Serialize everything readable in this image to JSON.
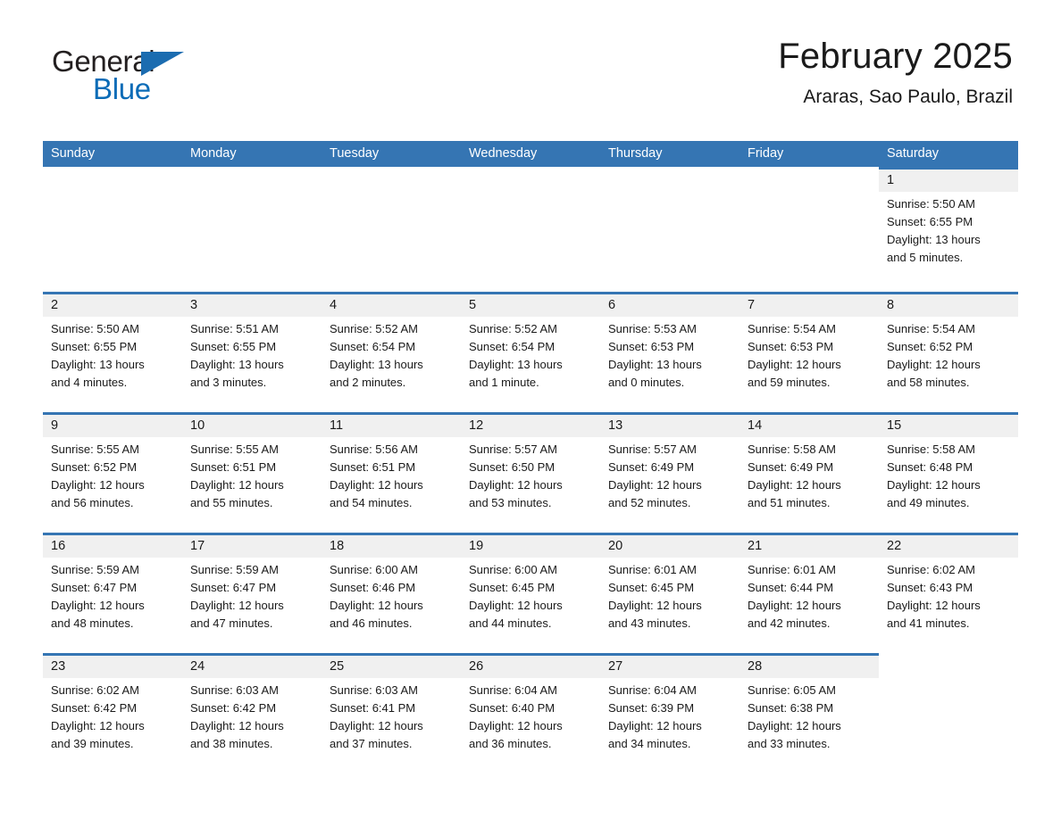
{
  "brand": {
    "name_part1": "General",
    "name_part2": "Blue",
    "logo_icon": "triangle-icon",
    "accent_color": "#0b6cb7"
  },
  "header": {
    "title": "February 2025",
    "subtitle": "Araras, Sao Paulo, Brazil"
  },
  "theme": {
    "header_bar_color": "#3575b3",
    "day_band_color": "#f0f0f0",
    "separator_color": "#3575b3",
    "text_color": "#1a1a1a"
  },
  "weekdays": [
    "Sunday",
    "Monday",
    "Tuesday",
    "Wednesday",
    "Thursday",
    "Friday",
    "Saturday"
  ],
  "weeks": [
    [
      {
        "day": "",
        "blank": true
      },
      {
        "day": "",
        "blank": true
      },
      {
        "day": "",
        "blank": true
      },
      {
        "day": "",
        "blank": true
      },
      {
        "day": "",
        "blank": true
      },
      {
        "day": "",
        "blank": true
      },
      {
        "day": "1",
        "sunrise": "Sunrise: 5:50 AM",
        "sunset": "Sunset: 6:55 PM",
        "daylight_line1": "Daylight: 13 hours",
        "daylight_line2": "and 5 minutes."
      }
    ],
    [
      {
        "day": "2",
        "sunrise": "Sunrise: 5:50 AM",
        "sunset": "Sunset: 6:55 PM",
        "daylight_line1": "Daylight: 13 hours",
        "daylight_line2": "and 4 minutes."
      },
      {
        "day": "3",
        "sunrise": "Sunrise: 5:51 AM",
        "sunset": "Sunset: 6:55 PM",
        "daylight_line1": "Daylight: 13 hours",
        "daylight_line2": "and 3 minutes."
      },
      {
        "day": "4",
        "sunrise": "Sunrise: 5:52 AM",
        "sunset": "Sunset: 6:54 PM",
        "daylight_line1": "Daylight: 13 hours",
        "daylight_line2": "and 2 minutes."
      },
      {
        "day": "5",
        "sunrise": "Sunrise: 5:52 AM",
        "sunset": "Sunset: 6:54 PM",
        "daylight_line1": "Daylight: 13 hours",
        "daylight_line2": "and 1 minute."
      },
      {
        "day": "6",
        "sunrise": "Sunrise: 5:53 AM",
        "sunset": "Sunset: 6:53 PM",
        "daylight_line1": "Daylight: 13 hours",
        "daylight_line2": "and 0 minutes."
      },
      {
        "day": "7",
        "sunrise": "Sunrise: 5:54 AM",
        "sunset": "Sunset: 6:53 PM",
        "daylight_line1": "Daylight: 12 hours",
        "daylight_line2": "and 59 minutes."
      },
      {
        "day": "8",
        "sunrise": "Sunrise: 5:54 AM",
        "sunset": "Sunset: 6:52 PM",
        "daylight_line1": "Daylight: 12 hours",
        "daylight_line2": "and 58 minutes."
      }
    ],
    [
      {
        "day": "9",
        "sunrise": "Sunrise: 5:55 AM",
        "sunset": "Sunset: 6:52 PM",
        "daylight_line1": "Daylight: 12 hours",
        "daylight_line2": "and 56 minutes."
      },
      {
        "day": "10",
        "sunrise": "Sunrise: 5:55 AM",
        "sunset": "Sunset: 6:51 PM",
        "daylight_line1": "Daylight: 12 hours",
        "daylight_line2": "and 55 minutes."
      },
      {
        "day": "11",
        "sunrise": "Sunrise: 5:56 AM",
        "sunset": "Sunset: 6:51 PM",
        "daylight_line1": "Daylight: 12 hours",
        "daylight_line2": "and 54 minutes."
      },
      {
        "day": "12",
        "sunrise": "Sunrise: 5:57 AM",
        "sunset": "Sunset: 6:50 PM",
        "daylight_line1": "Daylight: 12 hours",
        "daylight_line2": "and 53 minutes."
      },
      {
        "day": "13",
        "sunrise": "Sunrise: 5:57 AM",
        "sunset": "Sunset: 6:49 PM",
        "daylight_line1": "Daylight: 12 hours",
        "daylight_line2": "and 52 minutes."
      },
      {
        "day": "14",
        "sunrise": "Sunrise: 5:58 AM",
        "sunset": "Sunset: 6:49 PM",
        "daylight_line1": "Daylight: 12 hours",
        "daylight_line2": "and 51 minutes."
      },
      {
        "day": "15",
        "sunrise": "Sunrise: 5:58 AM",
        "sunset": "Sunset: 6:48 PM",
        "daylight_line1": "Daylight: 12 hours",
        "daylight_line2": "and 49 minutes."
      }
    ],
    [
      {
        "day": "16",
        "sunrise": "Sunrise: 5:59 AM",
        "sunset": "Sunset: 6:47 PM",
        "daylight_line1": "Daylight: 12 hours",
        "daylight_line2": "and 48 minutes."
      },
      {
        "day": "17",
        "sunrise": "Sunrise: 5:59 AM",
        "sunset": "Sunset: 6:47 PM",
        "daylight_line1": "Daylight: 12 hours",
        "daylight_line2": "and 47 minutes."
      },
      {
        "day": "18",
        "sunrise": "Sunrise: 6:00 AM",
        "sunset": "Sunset: 6:46 PM",
        "daylight_line1": "Daylight: 12 hours",
        "daylight_line2": "and 46 minutes."
      },
      {
        "day": "19",
        "sunrise": "Sunrise: 6:00 AM",
        "sunset": "Sunset: 6:45 PM",
        "daylight_line1": "Daylight: 12 hours",
        "daylight_line2": "and 44 minutes."
      },
      {
        "day": "20",
        "sunrise": "Sunrise: 6:01 AM",
        "sunset": "Sunset: 6:45 PM",
        "daylight_line1": "Daylight: 12 hours",
        "daylight_line2": "and 43 minutes."
      },
      {
        "day": "21",
        "sunrise": "Sunrise: 6:01 AM",
        "sunset": "Sunset: 6:44 PM",
        "daylight_line1": "Daylight: 12 hours",
        "daylight_line2": "and 42 minutes."
      },
      {
        "day": "22",
        "sunrise": "Sunrise: 6:02 AM",
        "sunset": "Sunset: 6:43 PM",
        "daylight_line1": "Daylight: 12 hours",
        "daylight_line2": "and 41 minutes."
      }
    ],
    [
      {
        "day": "23",
        "sunrise": "Sunrise: 6:02 AM",
        "sunset": "Sunset: 6:42 PM",
        "daylight_line1": "Daylight: 12 hours",
        "daylight_line2": "and 39 minutes."
      },
      {
        "day": "24",
        "sunrise": "Sunrise: 6:03 AM",
        "sunset": "Sunset: 6:42 PM",
        "daylight_line1": "Daylight: 12 hours",
        "daylight_line2": "and 38 minutes."
      },
      {
        "day": "25",
        "sunrise": "Sunrise: 6:03 AM",
        "sunset": "Sunset: 6:41 PM",
        "daylight_line1": "Daylight: 12 hours",
        "daylight_line2": "and 37 minutes."
      },
      {
        "day": "26",
        "sunrise": "Sunrise: 6:04 AM",
        "sunset": "Sunset: 6:40 PM",
        "daylight_line1": "Daylight: 12 hours",
        "daylight_line2": "and 36 minutes."
      },
      {
        "day": "27",
        "sunrise": "Sunrise: 6:04 AM",
        "sunset": "Sunset: 6:39 PM",
        "daylight_line1": "Daylight: 12 hours",
        "daylight_line2": "and 34 minutes."
      },
      {
        "day": "28",
        "sunrise": "Sunrise: 6:05 AM",
        "sunset": "Sunset: 6:38 PM",
        "daylight_line1": "Daylight: 12 hours",
        "daylight_line2": "and 33 minutes."
      },
      {
        "day": "",
        "blank": true
      }
    ]
  ]
}
